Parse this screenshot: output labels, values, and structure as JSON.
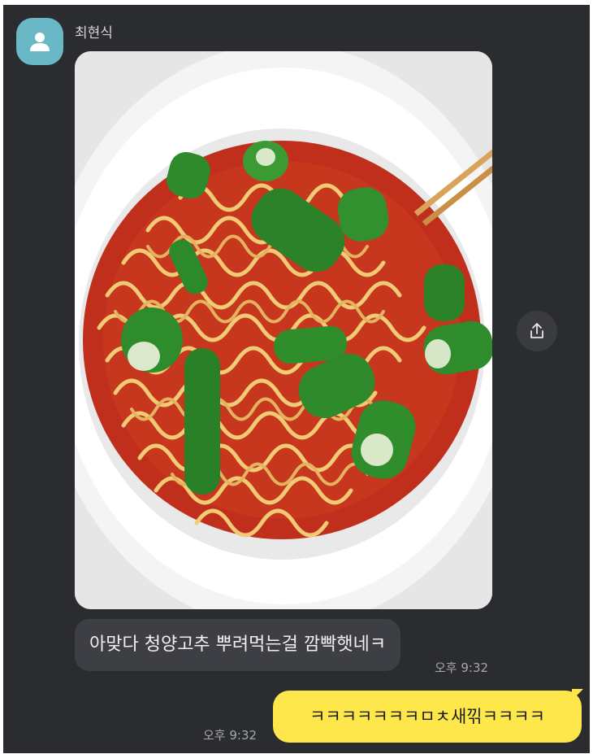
{
  "sender": {
    "name": "최현식"
  },
  "icons": {
    "avatar": "person-icon",
    "share": "share-icon"
  },
  "photo": {
    "description": "",
    "colors": {
      "bowl": "#efefef",
      "broth": "#c8321c",
      "noodle": "#f2cc7a",
      "pepper": "#2e8a2a"
    }
  },
  "messages": {
    "incoming": {
      "text": "아맞다 청양고추 뿌려먹는걸 깜빡햇네ㅋ",
      "time": "오후 9:32"
    },
    "outgoing": {
      "text": "ㅋㅋㅋㅋㅋㅋㅋㅁㅊ새끾ㅋㅋㅋㅋ",
      "time": "오후 9:32"
    }
  },
  "theme": {
    "background": "#2b2c30",
    "incoming_bubble": "#3e3f45",
    "outgoing_bubble": "#fde74b",
    "avatar": "#6ab8c5"
  }
}
